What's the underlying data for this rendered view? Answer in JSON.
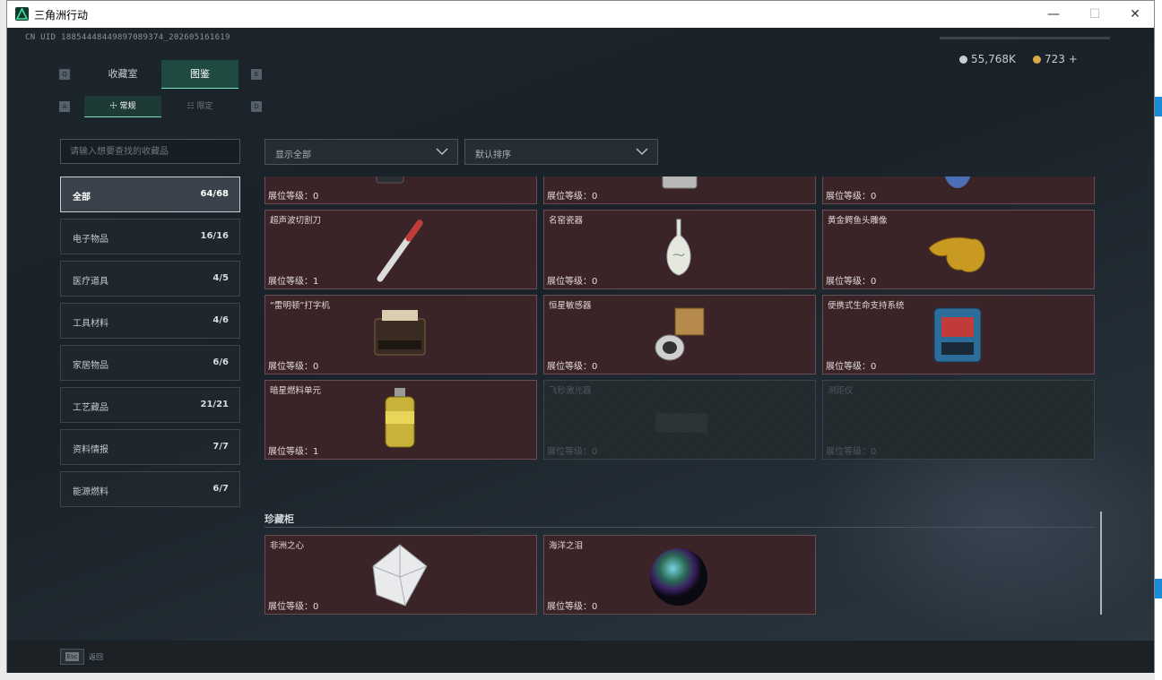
{
  "window": {
    "title": "三角洲行动"
  },
  "header": {
    "uid": "CN UID 18854448449897089374_202605161619",
    "currency": [
      {
        "value": "55,768K",
        "color": "#c8ced4"
      },
      {
        "value": "723 +",
        "color": "#d9a84a"
      }
    ]
  },
  "tabs": {
    "prev_key": "Q",
    "next_key": "E",
    "items": [
      {
        "label": "收藏室"
      },
      {
        "label": "图鉴"
      }
    ],
    "active": "图鉴"
  },
  "subtabs": {
    "prev_key": "A",
    "next_key": "D",
    "items": [
      {
        "label": "常规"
      },
      {
        "label": "限定"
      }
    ],
    "active": "常规"
  },
  "search": {
    "placeholder": "请输入想要查找的收藏品"
  },
  "filters": {
    "show_label": "显示全部",
    "sort_label": "默认排序"
  },
  "categories": [
    {
      "label": "全部",
      "count": "64/68",
      "active": true
    },
    {
      "label": "电子物品",
      "count": "16/16"
    },
    {
      "label": "医疗道具",
      "count": "4/5"
    },
    {
      "label": "工具材料",
      "count": "4/6"
    },
    {
      "label": "家居物品",
      "count": "6/6"
    },
    {
      "label": "工艺藏品",
      "count": "21/21"
    },
    {
      "label": "资料情报",
      "count": "7/7"
    },
    {
      "label": "能源燃料",
      "count": "6/7"
    }
  ],
  "grid": {
    "level_prefix": "展位等级：",
    "items": [
      {
        "name": "",
        "level": "0",
        "icon": "electronic-device-icon",
        "locked": false
      },
      {
        "name": "",
        "level": "0",
        "icon": "heater-icon",
        "locked": false
      },
      {
        "name": "",
        "level": "0",
        "icon": "gas-canister-icon",
        "locked": false
      },
      {
        "name": "超声波切割刀",
        "level": "1",
        "icon": "ultrasonic-cutter-icon",
        "locked": false
      },
      {
        "name": "名窑瓷器",
        "level": "0",
        "icon": "porcelain-vase-icon",
        "locked": false
      },
      {
        "name": "黄金鳄鱼头雕像",
        "level": "0",
        "icon": "golden-crocodile-icon",
        "locked": false
      },
      {
        "name": "“雷明顿”打字机",
        "level": "0",
        "icon": "typewriter-icon",
        "locked": false
      },
      {
        "name": "恒星敏感器",
        "level": "0",
        "icon": "star-sensor-icon",
        "locked": false
      },
      {
        "name": "便携式生命支持系统",
        "level": "0",
        "icon": "life-support-icon",
        "locked": false
      },
      {
        "name": "暗星燃料单元",
        "level": "1",
        "icon": "fuel-cell-icon",
        "locked": false
      },
      {
        "name": "飞秒激光器",
        "level": "0",
        "icon": "laser-icon",
        "locked": true
      },
      {
        "name": "测距仪",
        "level": "0",
        "icon": "rangefinder-icon",
        "locked": true
      }
    ]
  },
  "treasure": {
    "title": "珍藏柜",
    "items": [
      {
        "name": "非洲之心",
        "level": "0",
        "icon": "diamond-icon"
      },
      {
        "name": "海洋之泪",
        "level": "0",
        "icon": "pearl-orb-icon"
      }
    ]
  },
  "footer": {
    "key": "Esc",
    "label": "返回"
  }
}
